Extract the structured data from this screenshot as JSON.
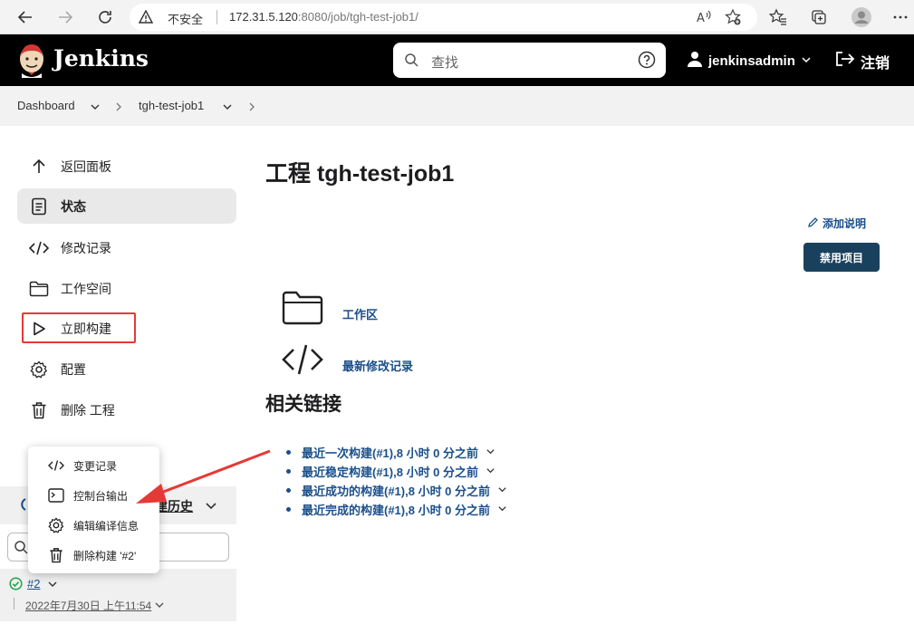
{
  "browser": {
    "insecure_label": "不安全",
    "url_host": "172.31.5.120",
    "url_rest": ":8080/job/tgh-test-job1/"
  },
  "header": {
    "brand": "Jenkins",
    "search_placeholder": "查找",
    "username": "jenkinsadmin",
    "logout": "注销"
  },
  "breadcrumb": {
    "items": [
      "Dashboard",
      "tgh-test-job1"
    ]
  },
  "sidebar": {
    "items": [
      {
        "label": "返回面板",
        "icon": "arrow-up-icon"
      },
      {
        "label": "状态",
        "icon": "document-icon"
      },
      {
        "label": "修改记录",
        "icon": "code-icon"
      },
      {
        "label": "工作空间",
        "icon": "folder-icon"
      },
      {
        "label": "立即构建",
        "icon": "play-icon"
      },
      {
        "label": "配置",
        "icon": "gear-icon"
      },
      {
        "label": "删除 工程",
        "icon": "trash-icon"
      }
    ],
    "history_title": "建历史",
    "build": {
      "number": "#2",
      "date": "2022年7月30日 上午11:54"
    }
  },
  "popup": {
    "items": [
      {
        "label": "变更记录",
        "icon": "code-icon"
      },
      {
        "label": "控制台输出",
        "icon": "terminal-icon"
      },
      {
        "label": "编辑编译信息",
        "icon": "gear-icon"
      },
      {
        "label": "删除构建 '#2'",
        "icon": "trash-icon"
      }
    ]
  },
  "main": {
    "title": "工程 tgh-test-job1",
    "add_description": "添加说明",
    "disable_button": "禁用项目",
    "workspace_link": "工作区",
    "changes_link": "最新修改记录",
    "related_title": "相关链接",
    "permalinks": [
      "最近一次构建(#1),8 小时 0 分之前",
      "最近稳定构建(#1),8 小时 0 分之前",
      "最近成功的构建(#1),8 小时 0 分之前",
      "最近完成的构建(#1),8 小时 0 分之前"
    ]
  },
  "colors": {
    "header_bg": "#000000",
    "link": "#1a4f8a",
    "primary_button": "#19415e",
    "annotation_red": "#e53935"
  }
}
